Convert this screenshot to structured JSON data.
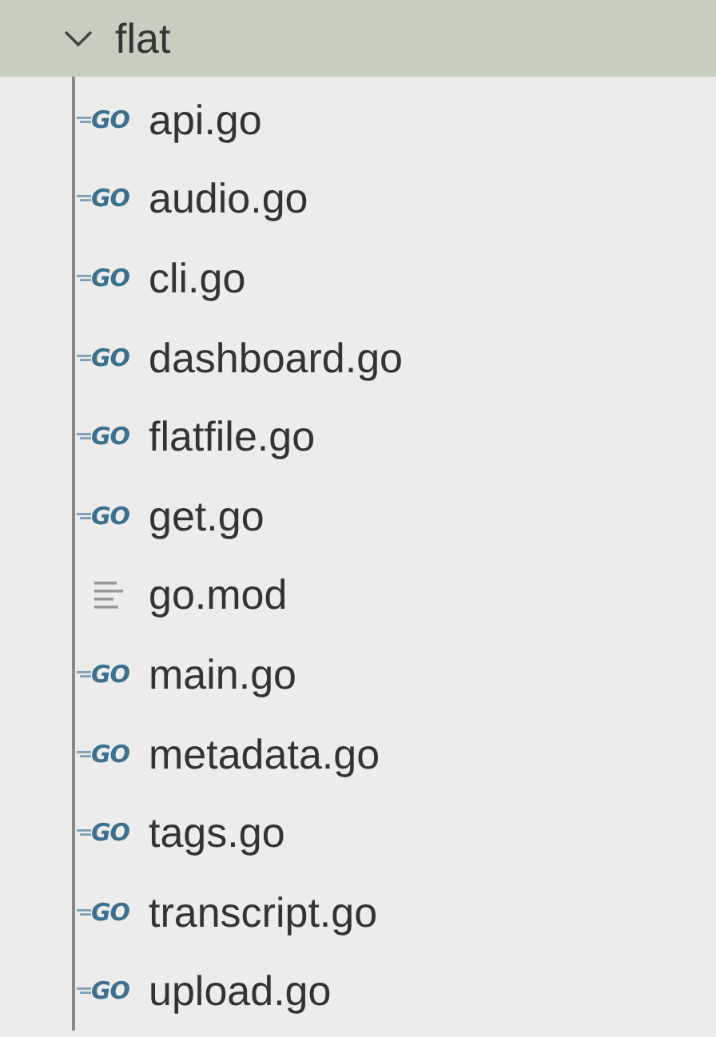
{
  "folder": {
    "name": "flat",
    "expanded": true,
    "selected": true
  },
  "files": [
    {
      "name": "api.go",
      "kind": "go",
      "badge": "GO"
    },
    {
      "name": "audio.go",
      "kind": "go",
      "badge": "GO"
    },
    {
      "name": "cli.go",
      "kind": "go",
      "badge": "GO"
    },
    {
      "name": "dashboard.go",
      "kind": "go",
      "badge": "GO"
    },
    {
      "name": "flatfile.go",
      "kind": "go",
      "badge": "GO"
    },
    {
      "name": "get.go",
      "kind": "go",
      "badge": "GO"
    },
    {
      "name": "go.mod",
      "kind": "text"
    },
    {
      "name": "main.go",
      "kind": "go",
      "badge": "GO"
    },
    {
      "name": "metadata.go",
      "kind": "go",
      "badge": "GO"
    },
    {
      "name": "tags.go",
      "kind": "go",
      "badge": "GO"
    },
    {
      "name": "transcript.go",
      "kind": "go",
      "badge": "GO"
    },
    {
      "name": "upload.go",
      "kind": "go",
      "badge": "GO"
    }
  ]
}
